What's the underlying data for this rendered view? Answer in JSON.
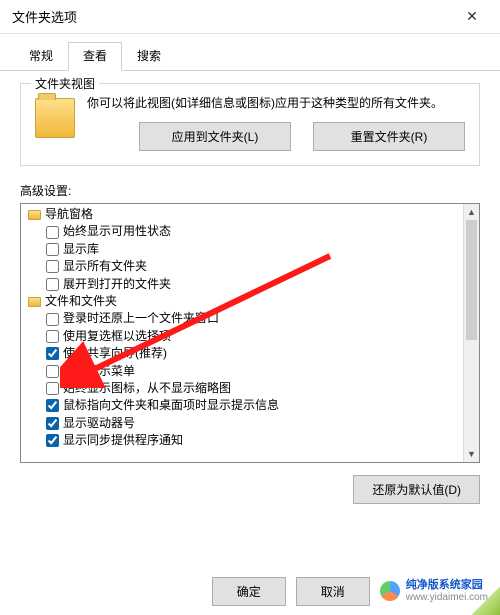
{
  "window": {
    "title": "文件夹选项",
    "close_label": "✕"
  },
  "tabs": [
    {
      "label": "常规",
      "active": false
    },
    {
      "label": "查看",
      "active": true
    },
    {
      "label": "搜索",
      "active": false
    }
  ],
  "folder_views": {
    "group_label": "文件夹视图",
    "description": "你可以将此视图(如详细信息或图标)应用于这种类型的所有文件夹。",
    "apply_button": "应用到文件夹(L)",
    "reset_button": "重置文件夹(R)"
  },
  "advanced": {
    "label": "高级设置:",
    "nodes": [
      {
        "type": "folder",
        "depth": 0,
        "label": "导航窗格"
      },
      {
        "type": "check",
        "depth": 1,
        "checked": false,
        "label": "始终显示可用性状态"
      },
      {
        "type": "check",
        "depth": 1,
        "checked": false,
        "label": "显示库"
      },
      {
        "type": "check",
        "depth": 1,
        "checked": false,
        "label": "显示所有文件夹"
      },
      {
        "type": "check",
        "depth": 1,
        "checked": false,
        "label": "展开到打开的文件夹"
      },
      {
        "type": "folder",
        "depth": 0,
        "label": "文件和文件夹"
      },
      {
        "type": "check",
        "depth": 1,
        "checked": false,
        "label": "登录时还原上一个文件夹窗口"
      },
      {
        "type": "check",
        "depth": 1,
        "checked": false,
        "label": "使用复选框以选择项"
      },
      {
        "type": "check",
        "depth": 1,
        "checked": true,
        "label": "使用共享向导(推荐)"
      },
      {
        "type": "check",
        "depth": 1,
        "checked": false,
        "label": "始终显示菜单"
      },
      {
        "type": "check",
        "depth": 1,
        "checked": false,
        "label": "始终显示图标，从不显示缩略图"
      },
      {
        "type": "check",
        "depth": 1,
        "checked": true,
        "label": "鼠标指向文件夹和桌面项时显示提示信息"
      },
      {
        "type": "check",
        "depth": 1,
        "checked": true,
        "label": "显示驱动器号"
      },
      {
        "type": "check",
        "depth": 1,
        "checked": true,
        "label": "显示同步提供程序通知"
      }
    ],
    "restore_button": "还原为默认值(D)"
  },
  "footer": {
    "ok": "确定",
    "cancel": "取消",
    "brand_name": "纯净版系统家园",
    "brand_url": "www.yidaimei.com"
  }
}
